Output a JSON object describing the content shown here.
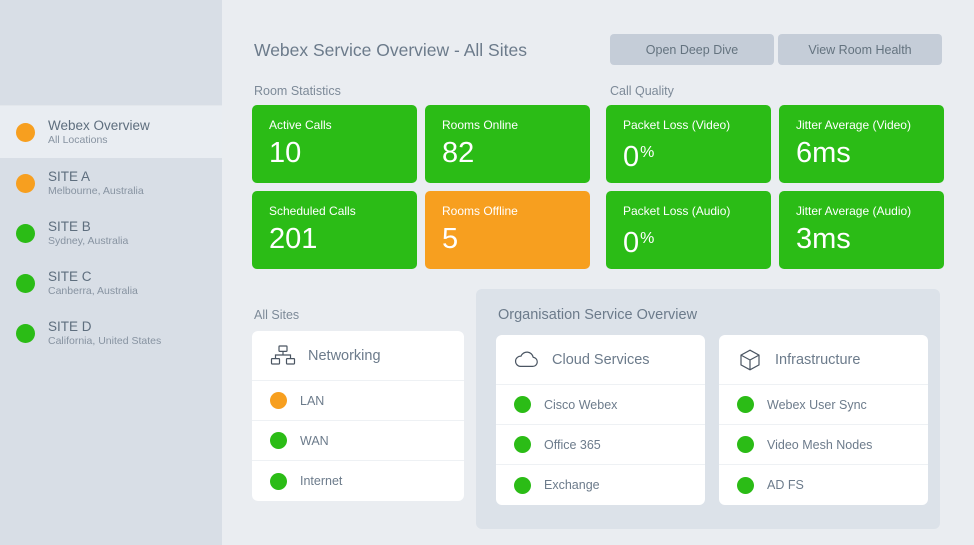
{
  "sidebar": {
    "items": [
      {
        "title": "Webex Overview",
        "subtitle": "All Locations",
        "status": "orange",
        "active": true
      },
      {
        "title": "SITE A",
        "subtitle": "Melbourne, Australia",
        "status": "orange",
        "active": false
      },
      {
        "title": "SITE B",
        "subtitle": "Sydney, Australia",
        "status": "green",
        "active": false
      },
      {
        "title": "SITE C",
        "subtitle": "Canberra, Australia",
        "status": "green",
        "active": false
      },
      {
        "title": "SITE D",
        "subtitle": "California, United States",
        "status": "green",
        "active": false
      }
    ]
  },
  "header": {
    "title": "Webex Service Overview - All Sites",
    "buttons": [
      {
        "label": "Open Deep Dive"
      },
      {
        "label": "View Room Health"
      }
    ]
  },
  "sections": {
    "room_statistics_label": "Room Statistics",
    "call_quality_label": "Call Quality",
    "all_sites_label": "All Sites",
    "organisation_label": "Organisation Service Overview"
  },
  "room_statistics": [
    {
      "label": "Active Calls",
      "value": "10",
      "unit": "",
      "color": "green"
    },
    {
      "label": "Rooms Online",
      "value": "82",
      "unit": "",
      "color": "green"
    },
    {
      "label": "Scheduled Calls",
      "value": "201",
      "unit": "",
      "color": "green"
    },
    {
      "label": "Rooms Offline",
      "value": "5",
      "unit": "",
      "color": "orange"
    }
  ],
  "call_quality": [
    {
      "label": "Packet Loss (Video)",
      "value": "0",
      "unit": "%",
      "color": "green"
    },
    {
      "label": "Jitter Average (Video)",
      "value": "6",
      "unit": "ms",
      "color": "green"
    },
    {
      "label": "Packet Loss (Audio)",
      "value": "0",
      "unit": "%",
      "color": "green"
    },
    {
      "label": "Jitter Average (Audio)",
      "value": "3",
      "unit": "ms",
      "color": "green"
    }
  ],
  "networking_card": {
    "icon": "sitemap-icon",
    "title": "Networking",
    "rows": [
      {
        "label": "LAN",
        "status": "orange"
      },
      {
        "label": "WAN",
        "status": "green"
      },
      {
        "label": "Internet",
        "status": "green"
      }
    ]
  },
  "cloud_services_card": {
    "icon": "cloud-icon",
    "title": "Cloud Services",
    "rows": [
      {
        "label": "Cisco Webex",
        "status": "green"
      },
      {
        "label": "Office 365",
        "status": "green"
      },
      {
        "label": "Exchange",
        "status": "green"
      }
    ]
  },
  "infrastructure_card": {
    "icon": "cube-icon",
    "title": "Infrastructure",
    "rows": [
      {
        "label": "Webex User Sync",
        "status": "green"
      },
      {
        "label": "Video Mesh Nodes",
        "status": "green"
      },
      {
        "label": "AD FS",
        "status": "green"
      }
    ]
  },
  "colors": {
    "status_green": "#2BBC16",
    "status_orange": "#F79F1F",
    "page_background": "#EAEDF1",
    "sidebar_background": "#D8DEE6",
    "panel_background": "#DCE2E9",
    "button_background": "#C5CDD8",
    "text_slate": "#6C7B8B"
  }
}
